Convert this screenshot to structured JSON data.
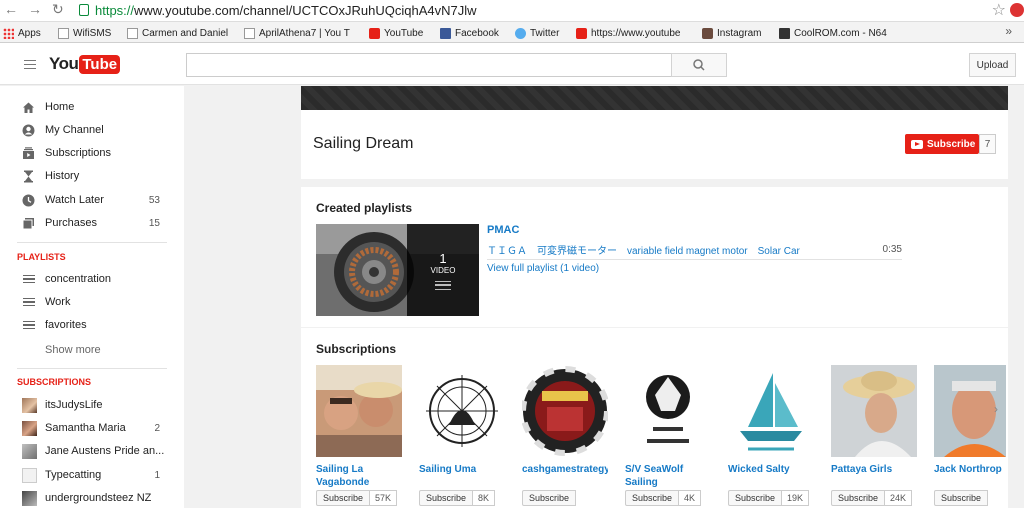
{
  "browser": {
    "url_proto": "https://",
    "url_rest": "www.youtube.com/channel/UCTCOxJRuhUQciqhA4vN7Jlw",
    "bookmarks": [
      {
        "label": "Apps",
        "icon": "apps-grid-icon"
      },
      {
        "label": "WifiSMS",
        "icon": "page-icon"
      },
      {
        "label": "Carmen and Daniel",
        "icon": "page-icon"
      },
      {
        "label": "AprilAthena7 | You T",
        "icon": "page-icon"
      },
      {
        "label": "YouTube",
        "icon": "youtube-icon"
      },
      {
        "label": "Facebook",
        "icon": "facebook-icon"
      },
      {
        "label": "Twitter",
        "icon": "twitter-icon"
      },
      {
        "label": "https://www.youtube",
        "icon": "youtube-icon"
      },
      {
        "label": "Instagram",
        "icon": "instagram-icon"
      },
      {
        "label": "CoolROM.com - N64",
        "icon": "coolrom-icon"
      }
    ],
    "more": "»"
  },
  "header": {
    "logo_you": "You",
    "logo_tube": "Tube",
    "upload": "Upload"
  },
  "sidebar": {
    "main": [
      {
        "label": "Home",
        "icon": "home-icon",
        "count": ""
      },
      {
        "label": "My Channel",
        "icon": "person-icon",
        "count": ""
      },
      {
        "label": "Subscriptions",
        "icon": "subscriptions-icon",
        "count": ""
      },
      {
        "label": "History",
        "icon": "hourglass-icon",
        "count": ""
      },
      {
        "label": "Watch Later",
        "icon": "clock-icon",
        "count": "53"
      },
      {
        "label": "Purchases",
        "icon": "purchases-icon",
        "count": "15"
      }
    ],
    "playlists_heading": "PLAYLISTS",
    "playlists": [
      {
        "label": "concentration"
      },
      {
        "label": "Work"
      },
      {
        "label": "favorites"
      }
    ],
    "show_more": "Show more",
    "subscriptions_heading": "SUBSCRIPTIONS",
    "subscriptions": [
      {
        "label": "itsJudysLife",
        "count": ""
      },
      {
        "label": "Samantha Maria",
        "count": "2"
      },
      {
        "label": "Jane Austens Pride an...",
        "count": ""
      },
      {
        "label": "Typecatting",
        "count": "1"
      },
      {
        "label": "undergroundsteez NZ",
        "count": ""
      }
    ]
  },
  "channel": {
    "name": "Sailing Dream",
    "subscribe": "Subscribe",
    "subscriber_count": "7"
  },
  "playlists_section": {
    "title": "Created playlists",
    "playlist": {
      "title": "PMAC",
      "video_count": "1",
      "video_label": "VIDEO",
      "video_title": "ＴＩＧＡ　可変界磁モーター　variable field magnet motor　Solar Car",
      "duration": "0:35",
      "view_full": "View full playlist (1 video)"
    }
  },
  "subscriptions_section": {
    "title": "Subscriptions",
    "channels": [
      {
        "name": "Sailing La Vagabonde",
        "count": "57K"
      },
      {
        "name": "Sailing Uma",
        "count": "8K"
      },
      {
        "name": "cashgamestrategy",
        "count": ""
      },
      {
        "name": "S/V SeaWolf Sailing",
        "count": "4K"
      },
      {
        "name": "Wicked Salty",
        "count": "19K"
      },
      {
        "name": "Pattaya Girls",
        "count": "24K"
      },
      {
        "name": "Jack Northrop",
        "count": ""
      }
    ],
    "subscribe_label": "Subscribe"
  },
  "colors": {
    "brand_red": "#e62117",
    "link_blue": "#167ac6"
  }
}
